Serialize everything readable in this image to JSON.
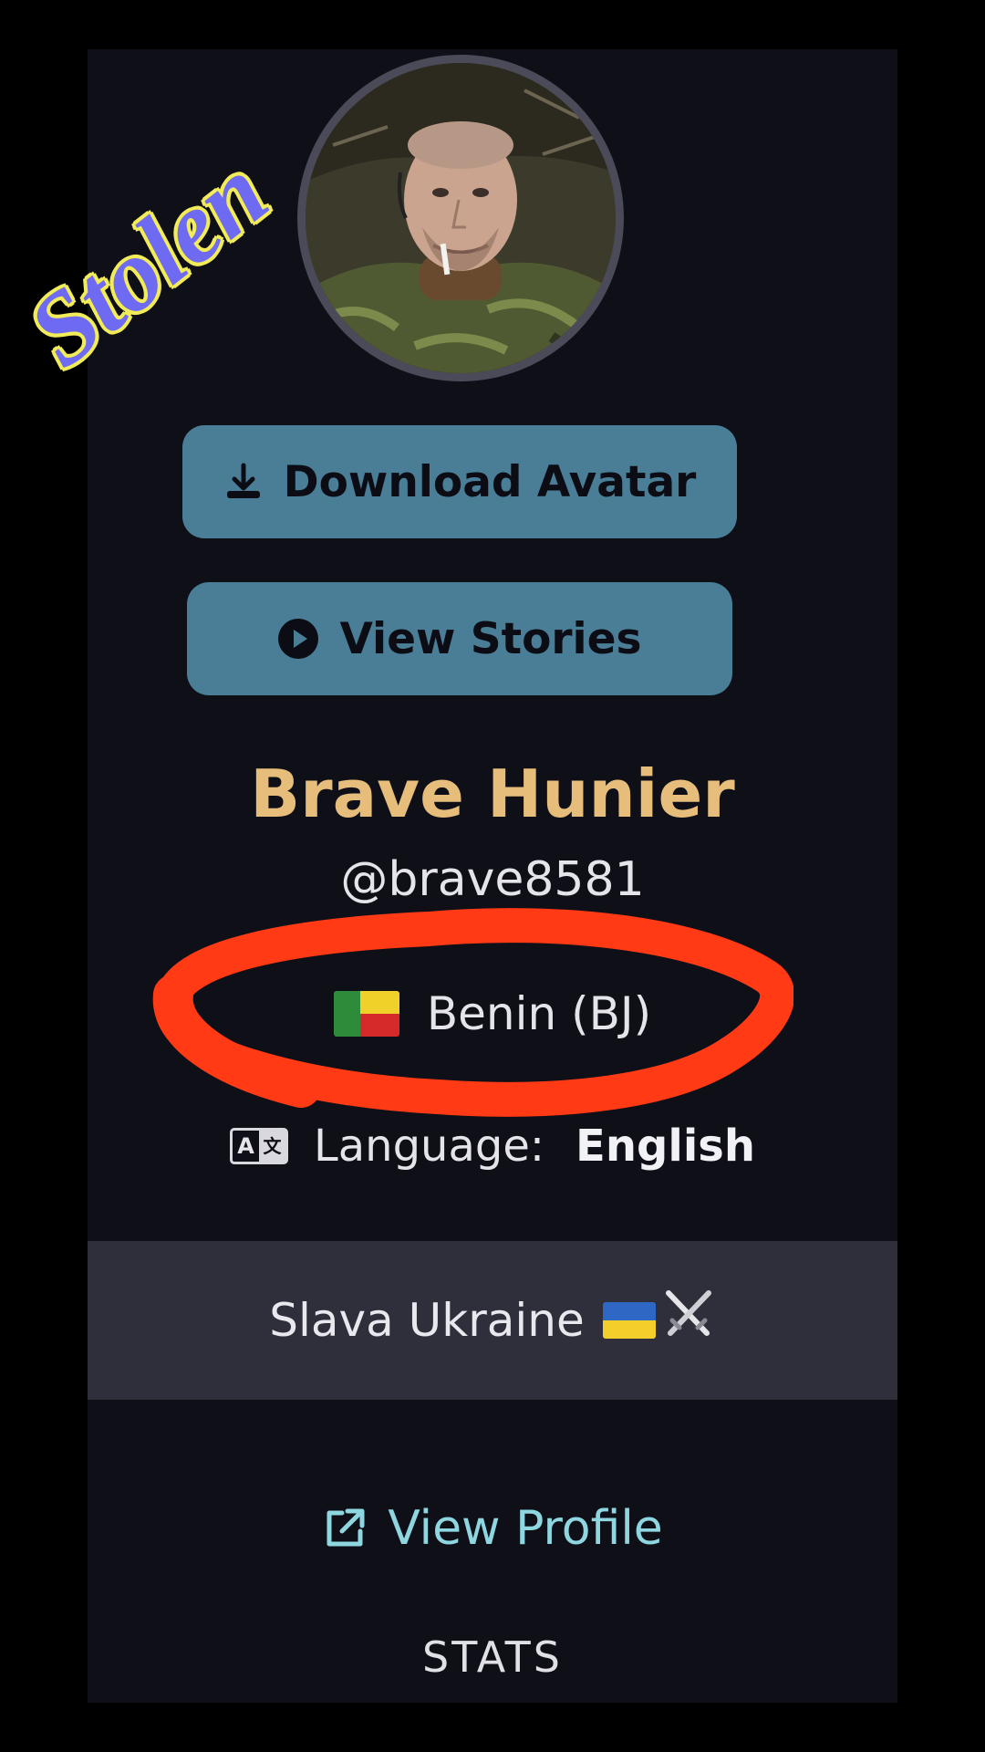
{
  "watermark": "Stolen",
  "profile": {
    "avatar_icon": "profile-photo",
    "name": "Brave Hunier",
    "handle": "@brave8581",
    "country": "Benin (BJ)",
    "country_flag": "benin-flag-icon",
    "language_label": "Language:",
    "language_value": "English",
    "bio": "Slava Ukraine",
    "bio_emoji": [
      "ukraine-flag-icon",
      "crossed-swords-icon"
    ]
  },
  "actions": {
    "download_avatar": "Download Avatar",
    "view_stories": "View Stories",
    "view_profile": "View Profile"
  },
  "sections": {
    "stats": "STATS"
  },
  "colors": {
    "panel_bg": "#0f0f18",
    "button_bg": "#4a7e97",
    "name_color": "#e6bd7a",
    "link_color": "#8fd7e0",
    "bio_bg": "#2f2f3b",
    "annotation_red": "#ff3a14"
  }
}
